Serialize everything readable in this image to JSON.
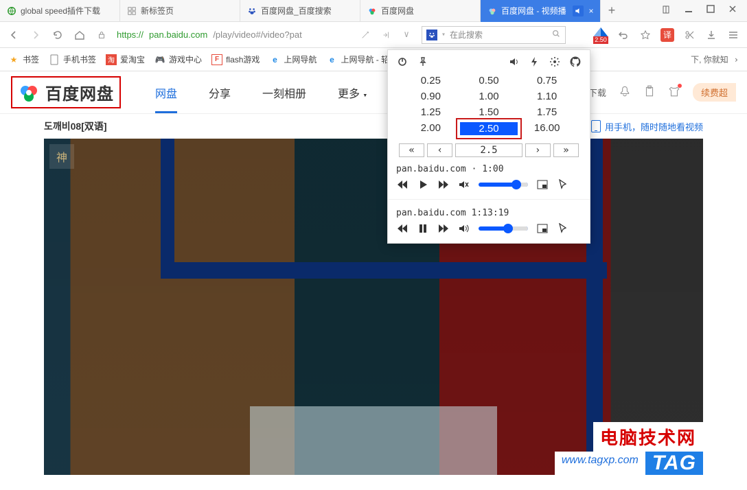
{
  "tabs": [
    {
      "label": "global speed插件下载"
    },
    {
      "label": "新标签页"
    },
    {
      "label": "百度网盘_百度搜索"
    },
    {
      "label": "百度网盘"
    },
    {
      "label": "百度网盘 - 视频播"
    }
  ],
  "tab_add": "+",
  "address": {
    "url_secure": "https://",
    "url_host": "pan.baidu.com",
    "url_path": "/play/video#/video?pat",
    "speed_badge": "2.50"
  },
  "search": {
    "placeholder": "在此搜索"
  },
  "translate_badge": "译",
  "bookmarks": {
    "star": "书签",
    "mobile": "手机书签",
    "taobao": "爱淘宝",
    "game": "游戏中心",
    "flash": "flash游戏",
    "nav1": "上网导航",
    "nav2": "上网导航 - 轺",
    "right": "下, 你就知"
  },
  "pan": {
    "logo_text": "百度网盘",
    "nav": {
      "disk": "网盘",
      "share": "分享",
      "album": "一刻相册",
      "more": "更多"
    },
    "right": {
      "client": "端下载",
      "vip": "续费超"
    }
  },
  "video": {
    "title": "도깨비08[双语]",
    "mobile_link": "用手机，随时随地看视频",
    "corner_mark": "神",
    "watermark_cn": "电脑技术网",
    "watermark_url": "www.tagxp.com",
    "watermark_tag": "TAG"
  },
  "gs": {
    "speeds": [
      [
        "0.25",
        "0.50",
        "0.75"
      ],
      [
        "0.90",
        "1.00",
        "1.10"
      ],
      [
        "1.25",
        "1.50",
        "1.75"
      ],
      [
        "2.00",
        "2.50",
        "16.00"
      ]
    ],
    "selected": "2.50",
    "step_back2": "«",
    "step_back1": "‹",
    "step_val": "2.5",
    "step_fwd1": "›",
    "step_fwd2": "»",
    "media1_label": "pan.baidu.com · 1:00",
    "media2_label": "pan.baidu.com 1:13:19"
  }
}
